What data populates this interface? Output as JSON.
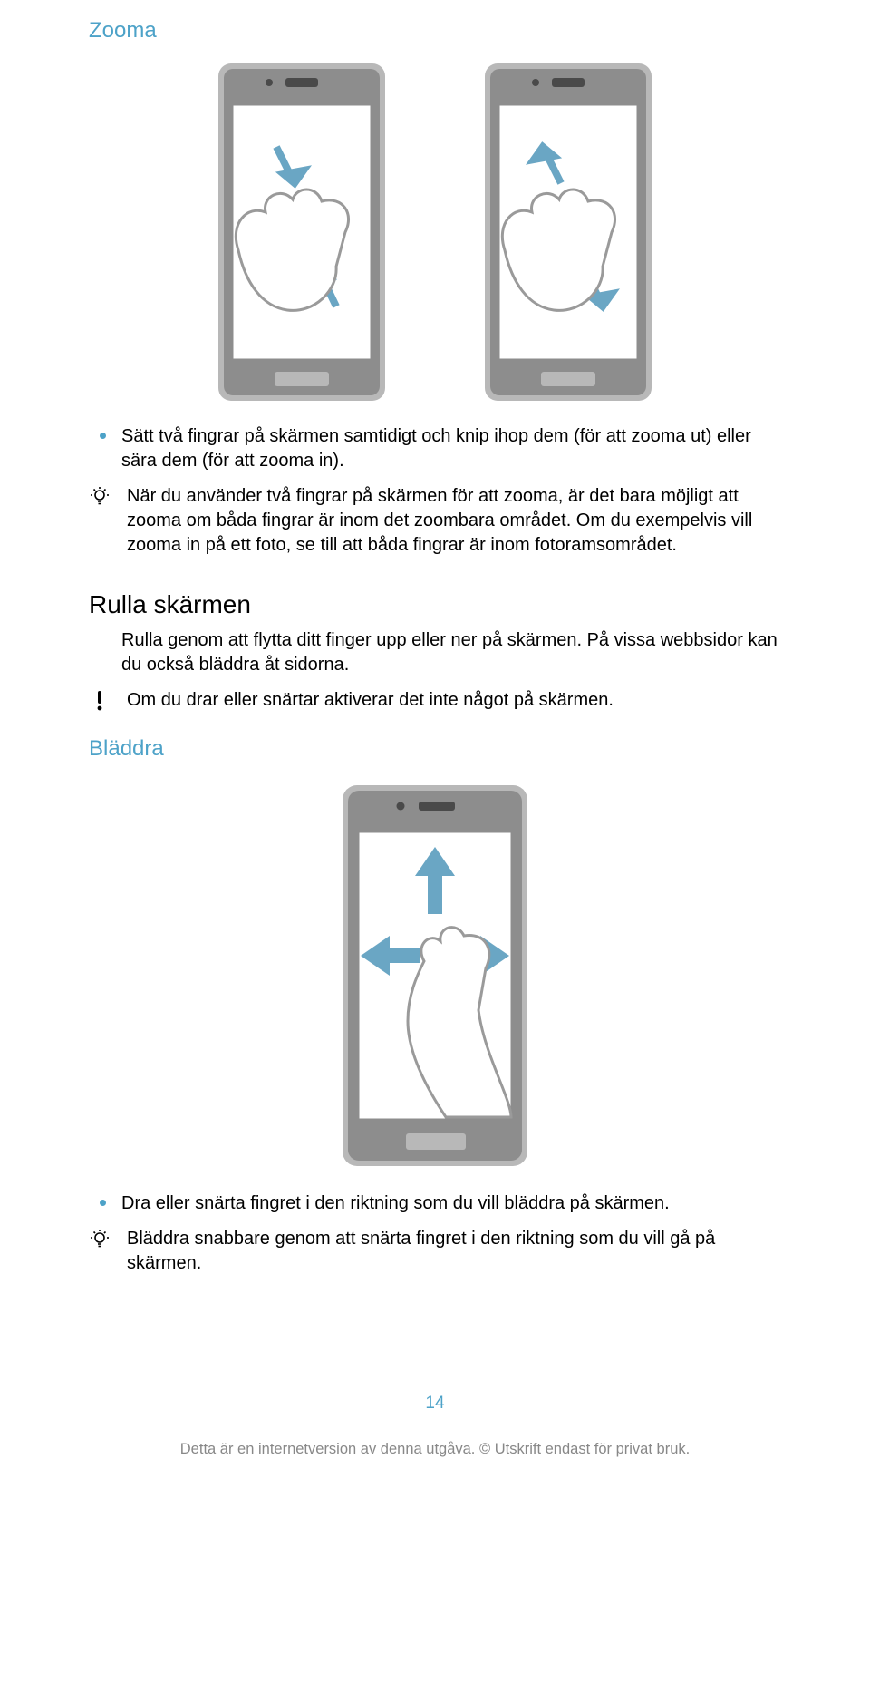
{
  "heading_zoom": "Zooma",
  "bullet_zoom": "Sätt två fingrar på skärmen samtidigt och knip ihop dem (för att zooma ut) eller sära dem (för att zooma in).",
  "tip_zoom": "När du använder två fingrar på skärmen för att zooma, är det bara möjligt att zooma om båda fingrar är inom det zoombara området. Om du exempelvis vill zooma in på ett foto, se till att båda fingrar är inom fotoramsområdet.",
  "heading_scroll": "Rulla skärmen",
  "body_scroll": "Rulla genom att flytta ditt finger upp eller ner på skärmen. På vissa webbsidor kan du också bläddra åt sidorna.",
  "warn_scroll": "Om du drar eller snärtar aktiverar det inte något på skärmen.",
  "heading_flick": "Bläddra",
  "bullet_flick": "Dra eller snärta fingret i den riktning som du vill bläddra på skärmen.",
  "tip_flick": "Bläddra snabbare genom att snärta fingret i den riktning som du vill gå på skärmen.",
  "page_number": "14",
  "footer": "Detta är en internetversion av denna utgåva. © Utskrift endast för privat bruk."
}
